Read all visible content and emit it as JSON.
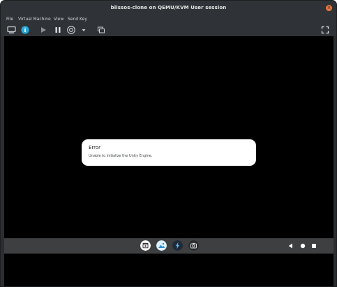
{
  "window": {
    "title": "blissos-clone on QEMU/KVM User session",
    "close_glyph": "×"
  },
  "menu": {
    "file": "File",
    "virtual_machine": "Virtual Machine",
    "view": "View",
    "send_key": "Send Key"
  },
  "toolbar": {
    "icons": [
      "monitor-icon",
      "info-icon",
      "play-icon",
      "pause-icon",
      "power-icon",
      "dropdown-arrow-icon",
      "snapshots-icon",
      "fullscreen-icon"
    ]
  },
  "dialog": {
    "title": "Error",
    "message": "Unable to initialize the Unity Engine."
  },
  "android_nav": {
    "apps": [
      "calendar-app-icon",
      "gallery-app-icon",
      "flash-app-icon",
      "camera-app-icon"
    ],
    "buttons": [
      "back-icon",
      "home-icon",
      "recents-icon"
    ]
  },
  "colors": {
    "accent_info": "#29a6d9",
    "close_button": "#e9773f",
    "dialog_bg": "#ffffff",
    "screen_bg": "#000000",
    "navbar_bg": "#3d3f41"
  }
}
